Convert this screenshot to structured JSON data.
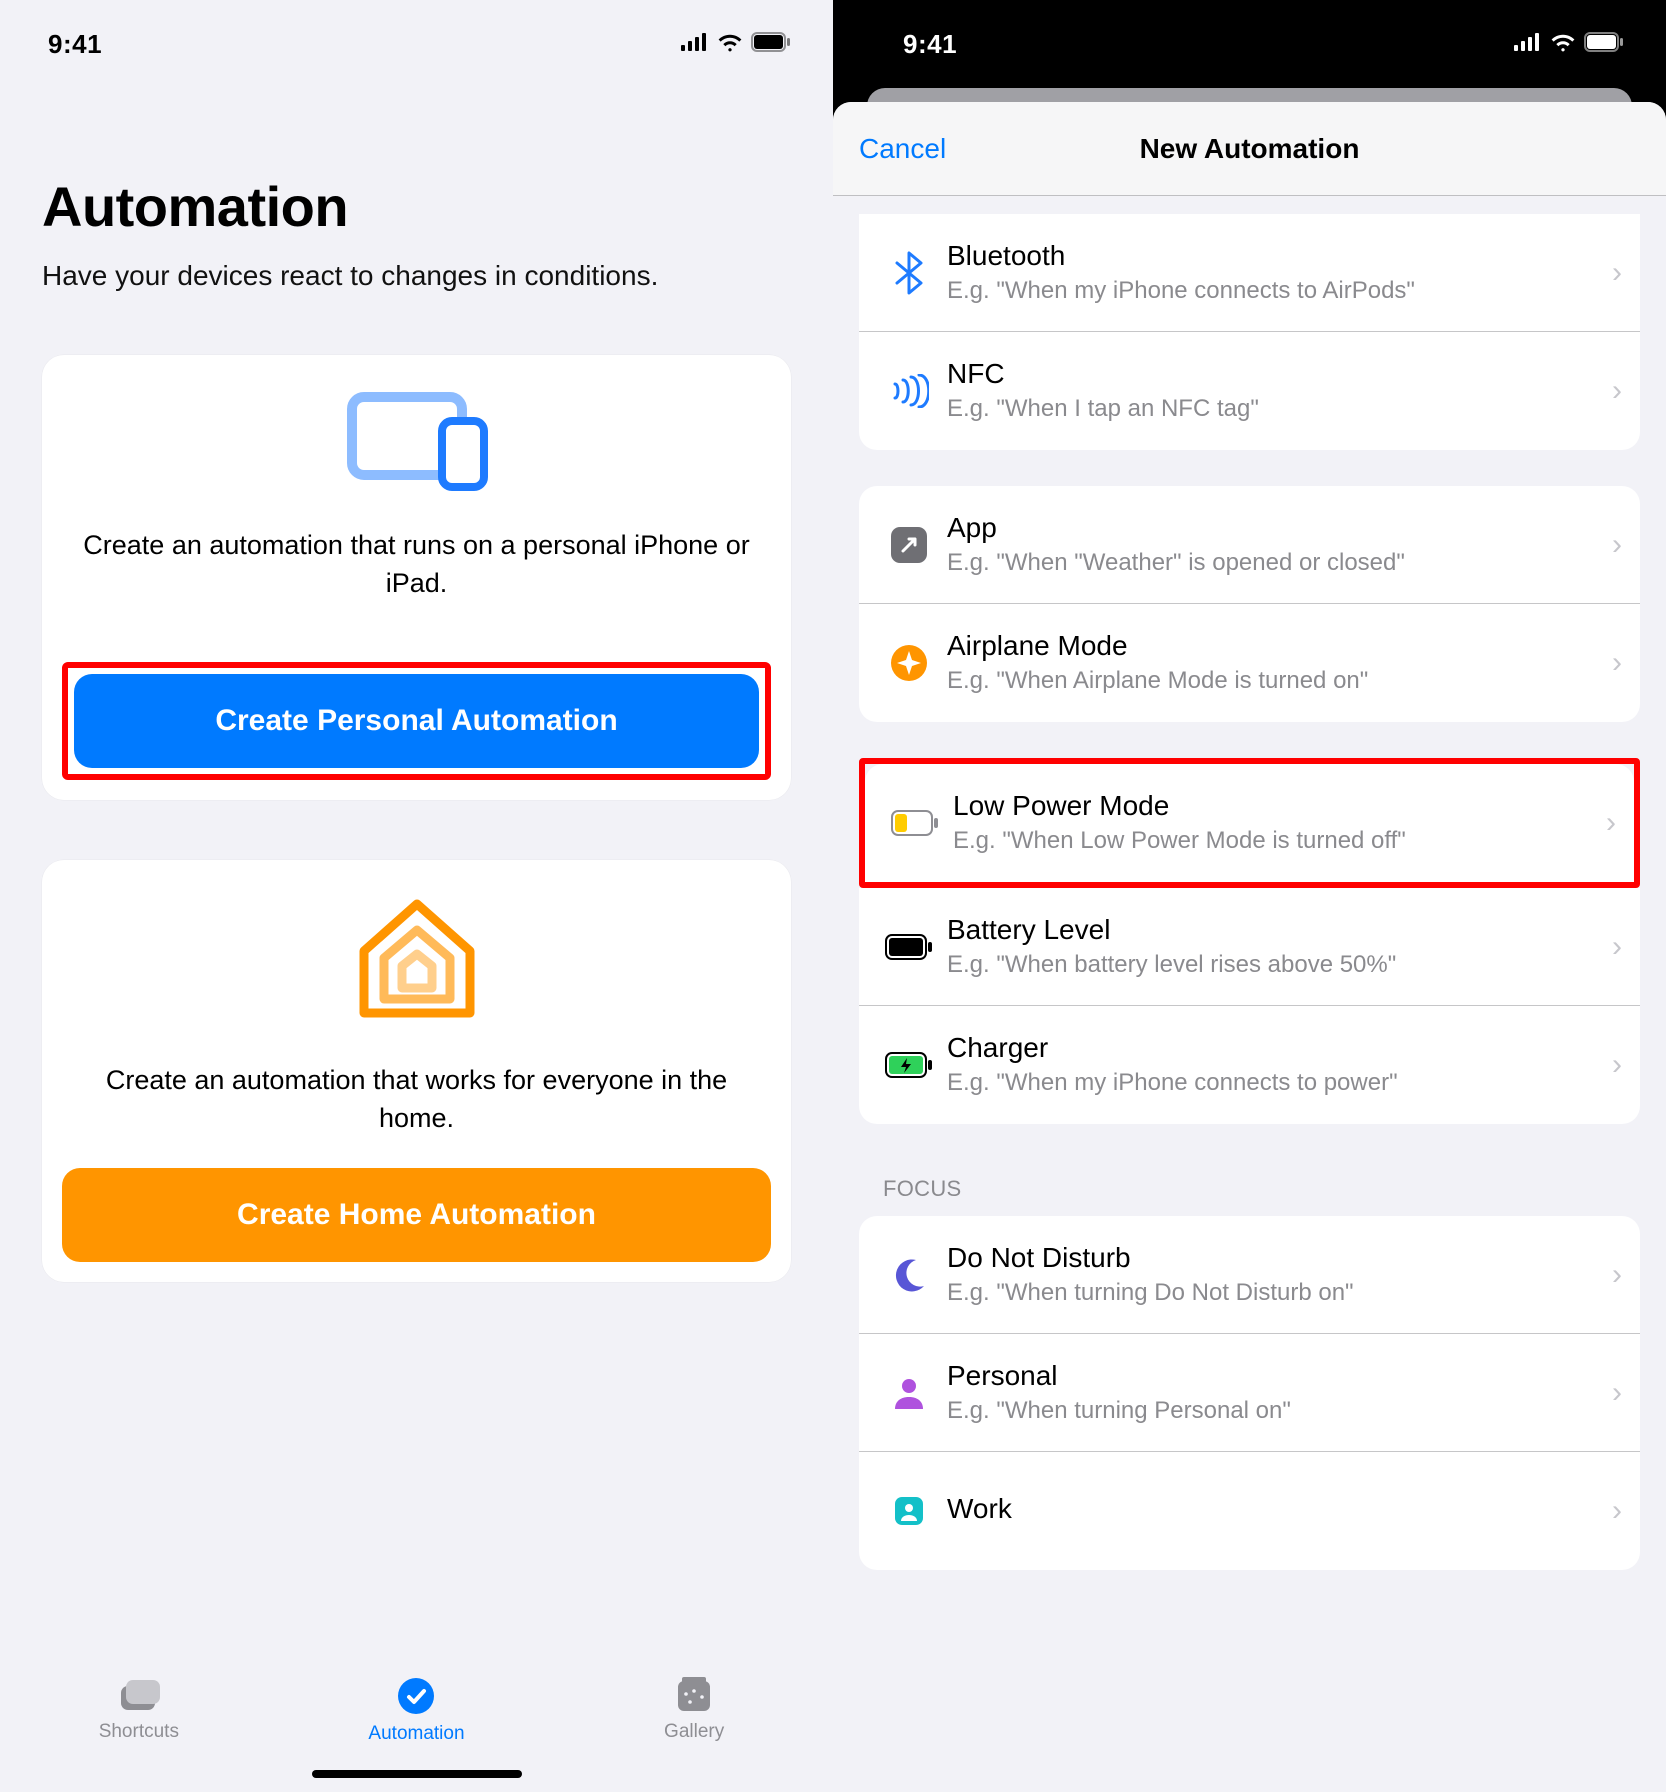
{
  "status": {
    "time": "9:41"
  },
  "left": {
    "title": "Automation",
    "subtitle": "Have your devices react to changes in conditions.",
    "personal": {
      "desc": "Create an automation that runs on a personal iPhone or iPad.",
      "button": "Create Personal Automation"
    },
    "home": {
      "desc": "Create an automation that works for everyone in the home.",
      "button": "Create Home Automation"
    },
    "tabs": {
      "shortcuts": "Shortcuts",
      "automation": "Automation",
      "gallery": "Gallery"
    }
  },
  "right": {
    "cancel": "Cancel",
    "title": "New Automation",
    "section_focus": "FOCUS",
    "rows": {
      "bluetooth": {
        "title": "Bluetooth",
        "desc": "E.g. \"When my iPhone connects to AirPods\""
      },
      "nfc": {
        "title": "NFC",
        "desc": "E.g. \"When I tap an NFC tag\""
      },
      "app": {
        "title": "App",
        "desc": "E.g. \"When \"Weather\" is opened or closed\""
      },
      "airplane": {
        "title": "Airplane Mode",
        "desc": "E.g. \"When Airplane Mode is turned on\""
      },
      "lowpower": {
        "title": "Low Power Mode",
        "desc": "E.g. \"When Low Power Mode is turned off\""
      },
      "battlevel": {
        "title": "Battery Level",
        "desc": "E.g. \"When battery level rises above 50%\""
      },
      "charger": {
        "title": "Charger",
        "desc": "E.g. \"When my iPhone connects to power\""
      },
      "dnd": {
        "title": "Do Not Disturb",
        "desc": "E.g. \"When turning Do Not Disturb on\""
      },
      "personal": {
        "title": "Personal",
        "desc": "E.g. \"When turning Personal on\""
      },
      "work": {
        "title": "Work",
        "desc": ""
      }
    }
  }
}
